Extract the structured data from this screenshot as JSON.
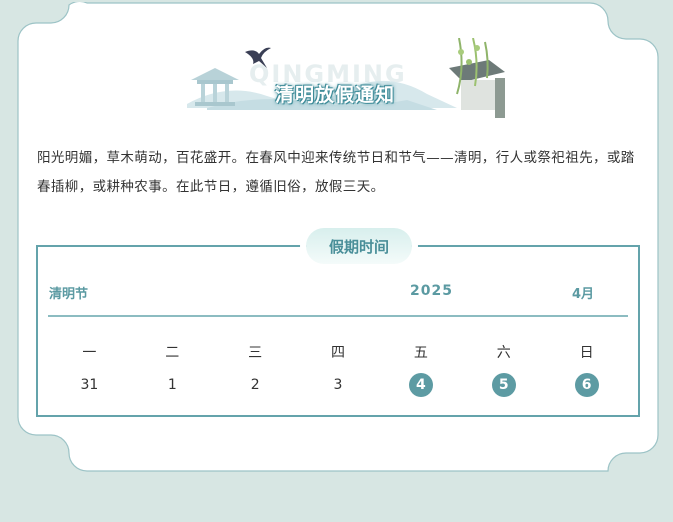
{
  "banner": {
    "title": "清明放假通知",
    "watermark": "QINGMING"
  },
  "intro": "阳光明媚，草木萌动，百花盛开。在春风中迎来传统节日和节气——清明，行人或祭祀祖先，或踏春插柳，或耕种农事。在此节日，遵循旧俗，放假三天。",
  "holiday": {
    "heading": "假期时间",
    "festival": "清明节",
    "year": "2025",
    "month": "4月",
    "weekdays": [
      "一",
      "二",
      "三",
      "四",
      "五",
      "六",
      "日"
    ],
    "dates": [
      {
        "day": "31",
        "holiday": false
      },
      {
        "day": "1",
        "holiday": false
      },
      {
        "day": "2",
        "holiday": false
      },
      {
        "day": "3",
        "holiday": false
      },
      {
        "day": "4",
        "holiday": true
      },
      {
        "day": "5",
        "holiday": true
      },
      {
        "day": "6",
        "holiday": true
      }
    ]
  },
  "colors": {
    "accent": "#5d9ba3",
    "border": "#64a3ab",
    "background": "#d7e6e3"
  }
}
